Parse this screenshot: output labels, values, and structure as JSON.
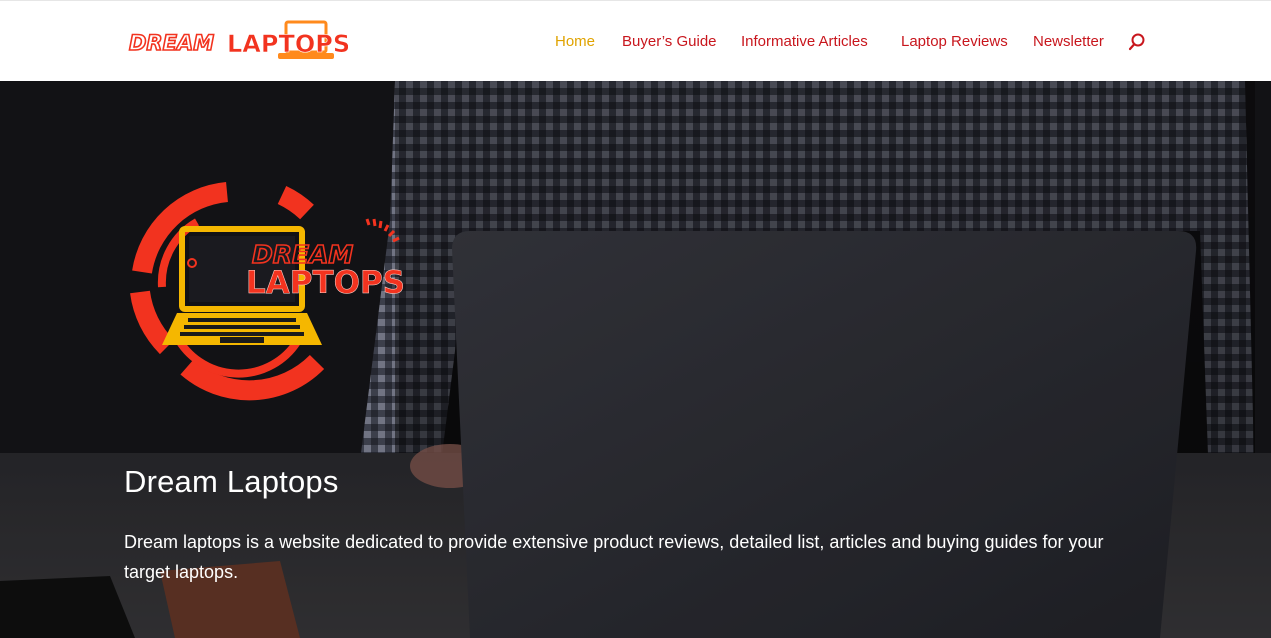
{
  "brand": {
    "logo_text_white": "DREAM",
    "logo_text_red": "LAPTOPS",
    "colors": {
      "red": "#f2331f",
      "orange": "#ff6a00",
      "gold": "#f5b700",
      "nav_red": "#c8161d",
      "active_gold": "#e0a300"
    }
  },
  "nav": {
    "items": [
      {
        "label": "Home",
        "active": true
      },
      {
        "label": "Buyer’s Guide",
        "active": false
      },
      {
        "label": "Informative Articles",
        "active": false
      },
      {
        "label": "Laptop Reviews",
        "active": false
      },
      {
        "label": "Newsletter",
        "active": false
      }
    ],
    "search_icon": "search-icon"
  },
  "hero": {
    "logo_line1": "DREAM",
    "logo_line2": "LAPTOPS",
    "title": "Dream Laptops",
    "description": "Dream laptops is a website dedicated to provide extensive product reviews, detailed list, articles and buying guides for your target laptops."
  }
}
